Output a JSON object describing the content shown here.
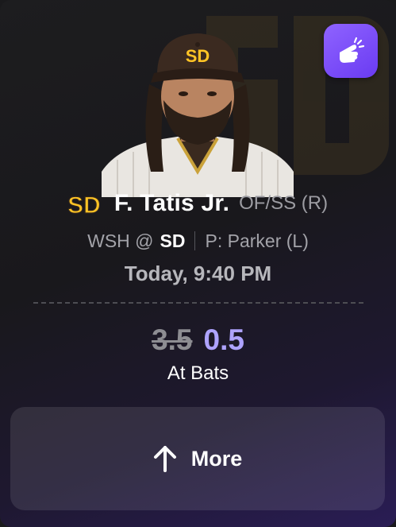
{
  "player": {
    "name": "F. Tatis Jr.",
    "position": "OF/SS (R)",
    "team_logo_text": "SD"
  },
  "matchup": {
    "away": "WSH @",
    "home": "SD",
    "pitcher": "P: Parker (L)"
  },
  "game_time": "Today, 9:40 PM",
  "line": {
    "old_value": "3.5",
    "new_value": "0.5",
    "stat": "At Bats"
  },
  "more_button": {
    "label": "More",
    "icon": "arrow-up-icon"
  },
  "tap_button": {
    "icon": "tap-hand-icon"
  },
  "colors": {
    "accent": "#8f63ff",
    "new_line": "#aea3ff",
    "team_gold": "#ffc425",
    "team_brown": "#2f241d"
  }
}
